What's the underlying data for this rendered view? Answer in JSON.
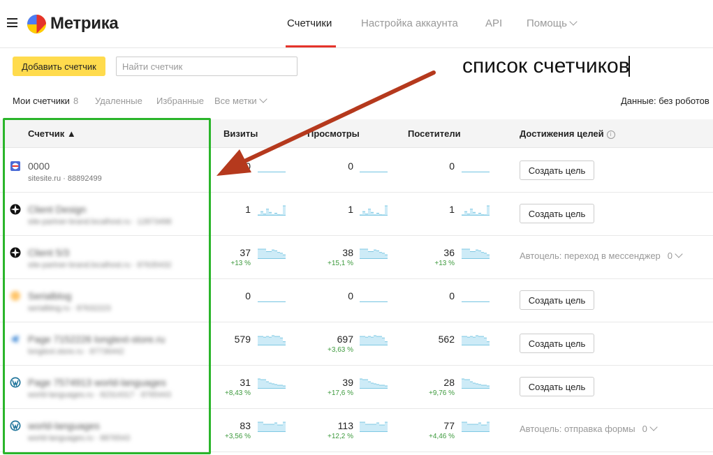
{
  "header": {
    "logo_text": "Метрика",
    "nav": [
      {
        "label": "Счетчики",
        "active": true
      },
      {
        "label": "Настройка аккаунта",
        "active": false
      },
      {
        "label": "API",
        "active": false
      },
      {
        "label": "Помощь",
        "active": false
      }
    ]
  },
  "toolbar": {
    "add_label": "Добавить счетчик",
    "search_placeholder": "Найти счетчик"
  },
  "annotation": {
    "text": "список счетчиков",
    "arrow_color": "#b5391d",
    "frame_color": "#2ab52a"
  },
  "filters": {
    "mine_label": "Мои счетчики",
    "mine_count": "8",
    "deleted_label": "Удаленные",
    "favorites_label": "Избранные",
    "tags_label": "Все метки",
    "data_label": "Данные: без роботов"
  },
  "table": {
    "headers": {
      "counter": "Счетчик ▲",
      "visits": "Визиты",
      "views": "Просмотры",
      "visitors": "Посетители",
      "goals": "Достижения целей"
    },
    "rows": [
      {
        "name": "0000",
        "sub": "sitesite.ru · 88892499",
        "blurred": false,
        "icon": "metrika-square-icon",
        "visits": "0",
        "visits_delta": "",
        "views": "0",
        "views_delta": "",
        "visitors": "0",
        "visitors_delta": "",
        "goal_button": "Создать цель",
        "goal_text": "",
        "goal_count": "",
        "spark": [
          0,
          0,
          0,
          0,
          0,
          0,
          0,
          0,
          0,
          0
        ]
      },
      {
        "name": "Client Design",
        "sub": "site-partner-brand.localhost.ru · 12873498",
        "blurred": true,
        "icon": "compass-icon",
        "visits": "1",
        "visits_delta": "",
        "views": "1",
        "views_delta": "",
        "visitors": "1",
        "visitors_delta": "",
        "goal_button": "Создать цель",
        "goal_text": "",
        "goal_count": "",
        "spark": [
          0,
          5,
          2,
          8,
          4,
          0,
          3,
          1,
          0,
          12
        ]
      },
      {
        "name": "Client 5/3",
        "sub": "site-partner-brand.localhost.ru · 87635432",
        "blurred": true,
        "icon": "compass-icon",
        "visits": "37",
        "visits_delta": "+13 %",
        "views": "38",
        "views_delta": "+15,1 %",
        "visitors": "36",
        "visitors_delta": "+13 %",
        "goal_button": "",
        "goal_text": "Автоцель: переход в мессенджер",
        "goal_count": "0",
        "spark": [
          12,
          12,
          12,
          9,
          9,
          11,
          10,
          8,
          7,
          5
        ]
      },
      {
        "name": "Serialblog",
        "sub": "serialblog.ru · 87632223",
        "blurred": true,
        "icon": "orange-circle-icon",
        "visits": "0",
        "visits_delta": "",
        "views": "0",
        "views_delta": "",
        "visitors": "0",
        "visitors_delta": "",
        "goal_button": "Создать цель",
        "goal_text": "",
        "goal_count": "",
        "spark": [
          0,
          0,
          0,
          0,
          0,
          0,
          0,
          0,
          0,
          0
        ]
      },
      {
        "name": "Page 7152226 longtext-store.ru",
        "sub": "longtext.store.ru · 87736442",
        "blurred": true,
        "icon": "blue-bird-icon",
        "visits": "579",
        "visits_delta": "",
        "views": "697",
        "views_delta": "+3,63 %",
        "visitors": "562",
        "visitors_delta": "",
        "goal_button": "Создать цель",
        "goal_text": "",
        "goal_count": "",
        "spark": [
          12,
          12,
          11,
          12,
          11,
          13,
          12,
          12,
          10,
          5
        ]
      },
      {
        "name": "Page 7574913 world-languages",
        "sub": "world-languages.ru · 82314317 · 8765443",
        "blurred": true,
        "icon": "wordpress-icon",
        "visits": "31",
        "visits_delta": "+8,43 %",
        "views": "39",
        "views_delta": "+17,6 %",
        "visitors": "28",
        "visitors_delta": "+9,76 %",
        "goal_button": "Создать цель",
        "goal_text": "",
        "goal_count": "",
        "spark": [
          14,
          13,
          13,
          10,
          8,
          7,
          6,
          5,
          5,
          4
        ]
      },
      {
        "name": "world-languages",
        "sub": "world-languages.ru · 8876543",
        "blurred": true,
        "icon": "wordpress-icon",
        "visits": "83",
        "visits_delta": "+3,56 %",
        "views": "113",
        "views_delta": "+12,2 %",
        "visitors": "77",
        "visitors_delta": "+4,46 %",
        "goal_button": "",
        "goal_text": "Автоцель: отправка формы",
        "goal_count": "0",
        "spark": [
          14,
          14,
          11,
          11,
          11,
          11,
          13,
          10,
          10,
          14
        ]
      }
    ]
  }
}
